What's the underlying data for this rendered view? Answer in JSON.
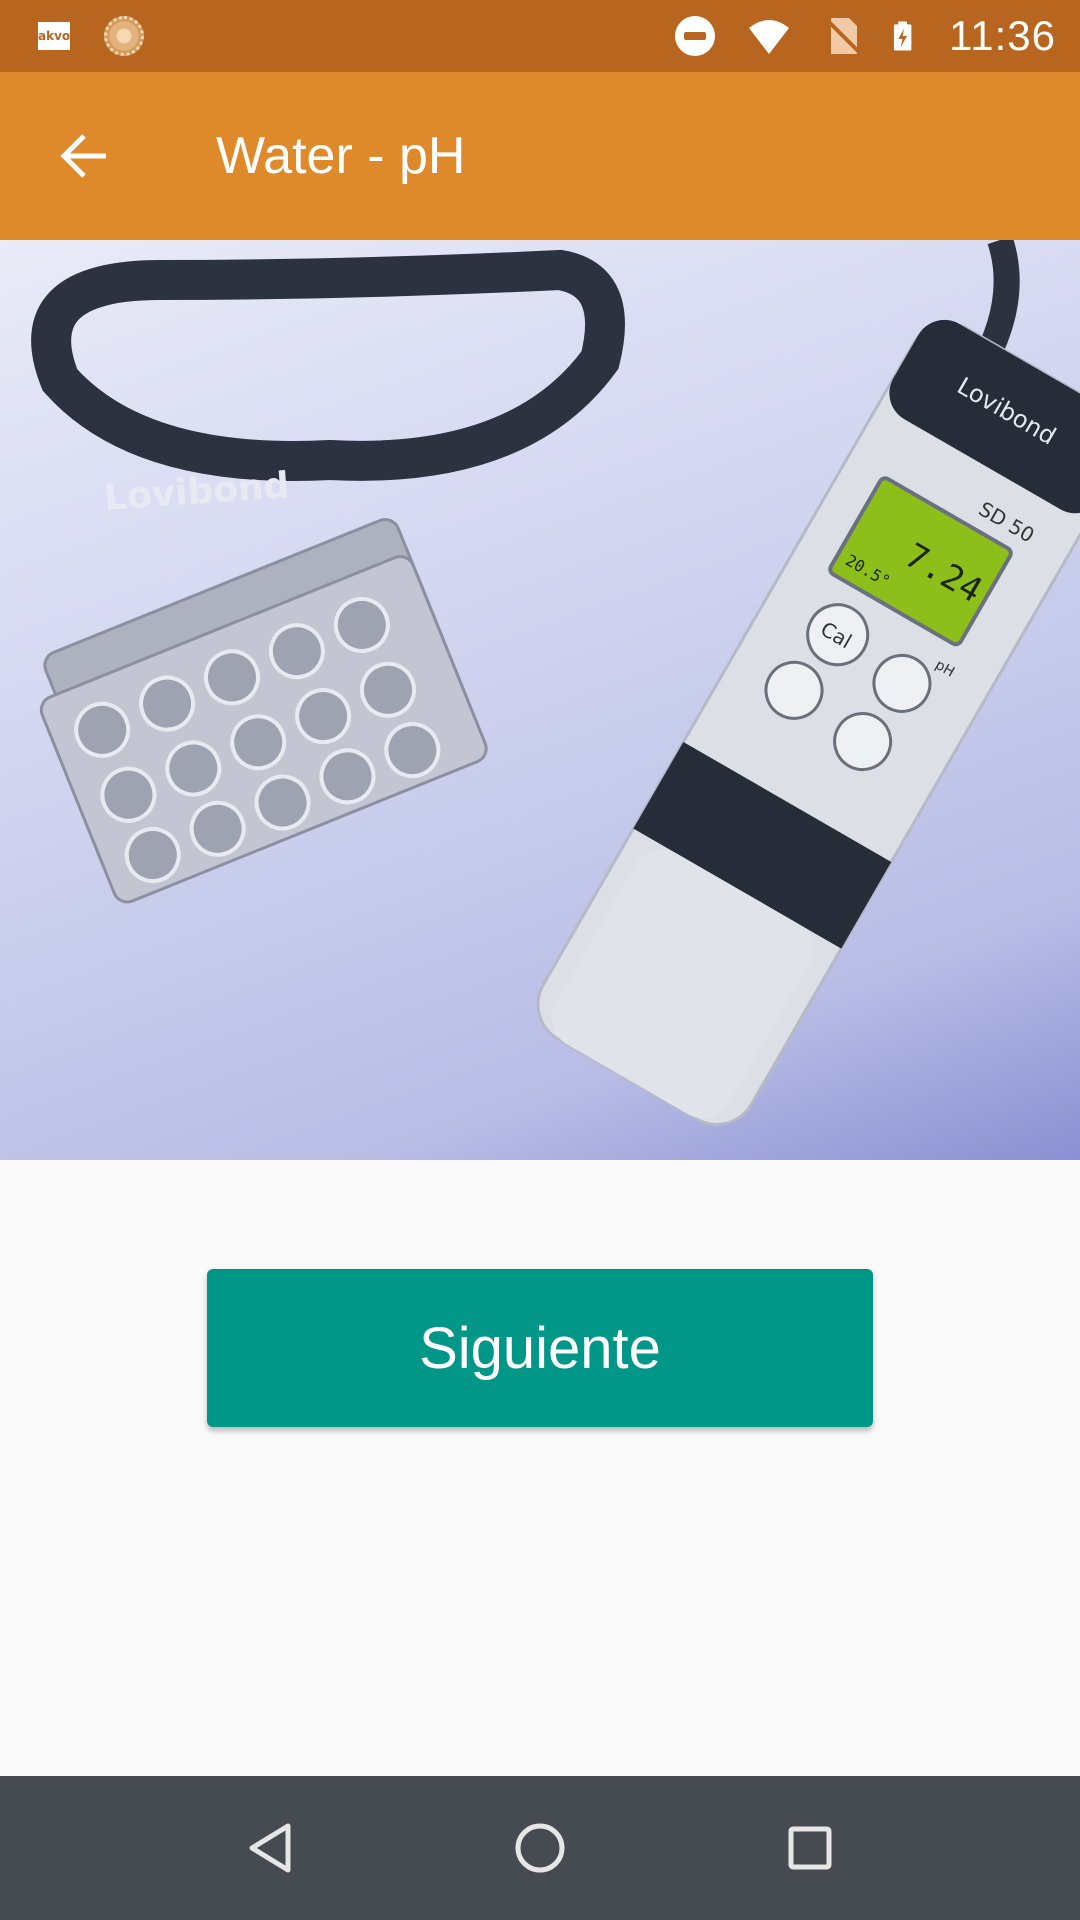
{
  "status_bar": {
    "app_icon_label": "akvo",
    "time": "11:36",
    "icons": [
      "akvo-app-icon",
      "sun-loading-icon",
      "do-not-disturb-icon",
      "wifi-icon",
      "no-sim-icon",
      "battery-charging-icon"
    ]
  },
  "app_bar": {
    "title": "Water - pH",
    "back_icon": "arrow-back-icon"
  },
  "hero_image": {
    "description_icon": "product-photo",
    "lanyard_brand": "Lovibond",
    "meter_brand": "Lovibond",
    "meter_model": "SD 50",
    "meter_reading": "7.24",
    "meter_temp": "20.5°",
    "meter_unit": "pH",
    "button_cal": "Cal"
  },
  "main": {
    "next_button_label": "Siguiente"
  },
  "nav_bar": {
    "icons": [
      "back-triangle-icon",
      "home-circle-icon",
      "recents-square-icon"
    ]
  },
  "colors": {
    "status_bar": "#b8651f",
    "app_bar": "#de8a2b",
    "button": "#009688",
    "nav_bar": "#454b50"
  }
}
